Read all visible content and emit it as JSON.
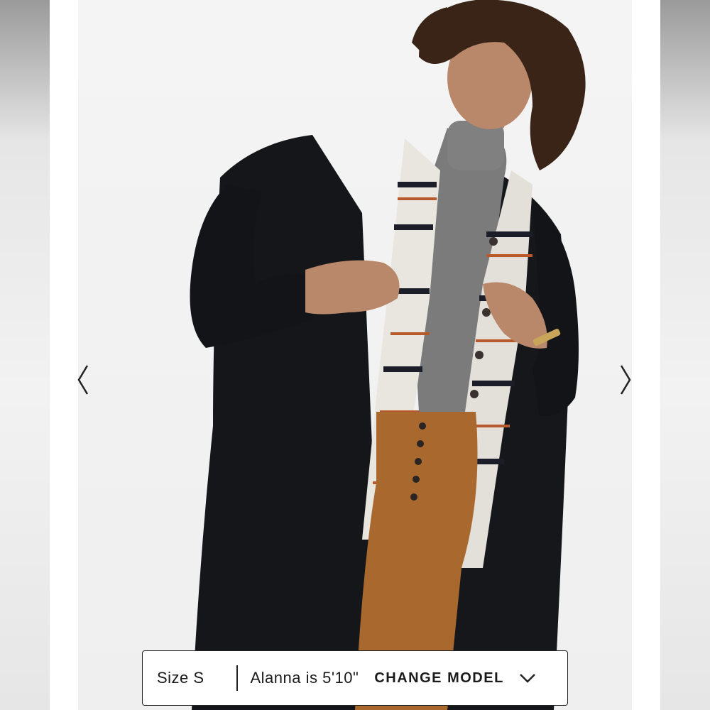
{
  "gallery": {
    "prev_icon": "chevron-left-icon",
    "next_icon": "chevron-right-icon",
    "image_subject": "product-photo"
  },
  "model_bar": {
    "size_label": "Size S",
    "model_label": "Alanna is 5'10\"",
    "change_model_label": "CHANGE MODEL",
    "dropdown_icon": "chevron-down-icon"
  },
  "colors": {
    "coat": "#15161a",
    "pants": "#a8682e",
    "sweater": "#7b7b7c",
    "plaid_accent": "#b8592a",
    "skin": "#b9876a",
    "hair": "#3a2417"
  }
}
